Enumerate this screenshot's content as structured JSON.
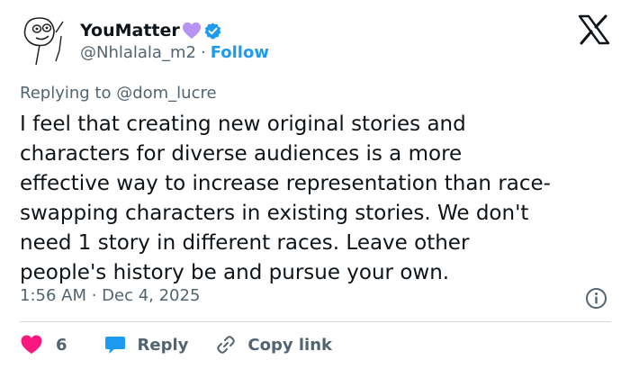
{
  "author": {
    "display_name": "YouMatter",
    "handle": "@Nhlalala_m2",
    "separator": "·",
    "follow_label": "Follow",
    "verified_color": "#1d9bf0",
    "heart_color": "#b794f4"
  },
  "tweet": {
    "replying_prefix": "Replying to ",
    "replying_to": "@dom_lucre",
    "text": "I feel that creating new original stories and\ncharacters for diverse audiences is a more\neffective way to increase representation than race-\nswapping characters in existing stories. We don't\nneed 1 story in different races. Leave other\npeople's history be and pursue your own.",
    "timestamp": "1:56 AM · Dec 4, 2025"
  },
  "actions": {
    "like_count": "6",
    "like_color": "#f91880",
    "reply_label": "Reply",
    "reply_color": "#1d9bf0",
    "copy_label": "Copy link"
  },
  "icons": {
    "avatar": "doodle-avatar",
    "brand": "x-logo-icon",
    "info": "info-icon",
    "like": "heart-icon",
    "reply": "reply-bubble-icon",
    "copy": "link-icon"
  }
}
